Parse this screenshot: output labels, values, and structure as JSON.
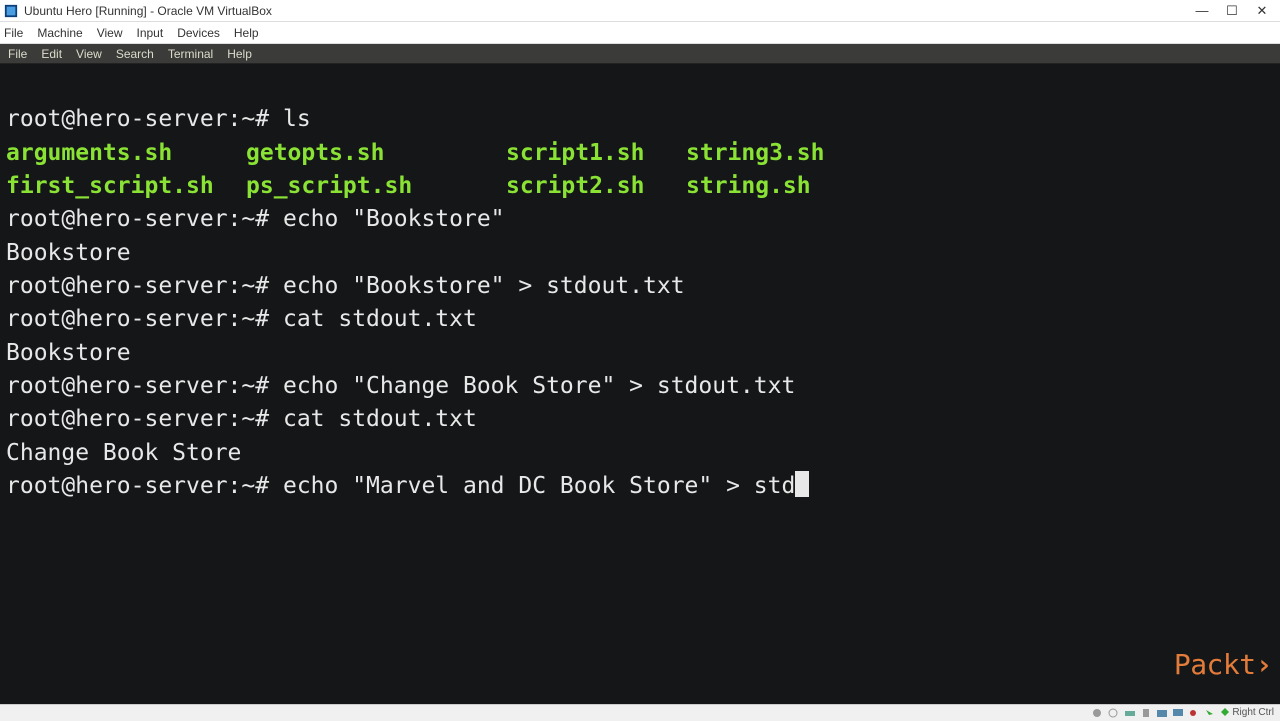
{
  "window": {
    "title": "Ubuntu Hero [Running] - Oracle VM VirtualBox"
  },
  "vbox_menu": {
    "file": "File",
    "machine": "Machine",
    "view": "View",
    "input": "Input",
    "devices": "Devices",
    "help": "Help"
  },
  "term_menu": {
    "file": "File",
    "edit": "Edit",
    "view": "View",
    "search": "Search",
    "terminal": "Terminal",
    "help": "Help"
  },
  "terminal": {
    "prompt": "root@hero-server:~#",
    "cmd_ls": "ls",
    "ls_output": {
      "r1c1": "arguments.sh",
      "r1c2": "getopts.sh",
      "r1c3": "script1.sh",
      "r1c4": "string3.sh",
      "r2c1": "first_script.sh",
      "r2c2": "ps_script.sh",
      "r2c3": "script2.sh",
      "r2c4": "string.sh"
    },
    "cmd2": "echo \"Bookstore\"",
    "out2": "Bookstore",
    "cmd3": "echo \"Bookstore\" > stdout.txt",
    "cmd4": "cat stdout.txt",
    "out4": "Bookstore",
    "cmd5": "echo \"Change Book Store\" > stdout.txt",
    "cmd6": "cat stdout.txt",
    "out6": "Change Book Store",
    "cmd7": "echo \"Marvel and DC Book Store\" > std"
  },
  "statusbar": {
    "hostkey": "Right Ctrl"
  },
  "watermark": "Packt"
}
